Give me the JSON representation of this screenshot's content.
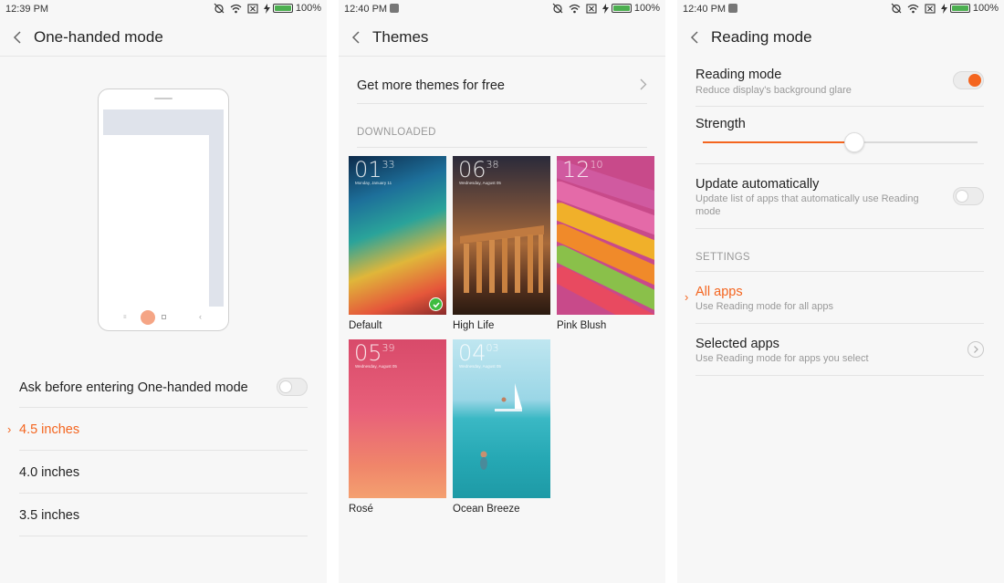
{
  "screen1": {
    "time": "12:39 PM",
    "battery": "100%",
    "title": "One-handed mode",
    "ask_label": "Ask before entering One-handed mode",
    "ask_toggle": false,
    "sizes": [
      {
        "label": "4.5 inches",
        "selected": true
      },
      {
        "label": "4.0 inches",
        "selected": false
      },
      {
        "label": "3.5 inches",
        "selected": false
      }
    ]
  },
  "screen2": {
    "time": "12:40 PM",
    "battery": "100%",
    "title": "Themes",
    "more_label": "Get more themes for free",
    "section": "DOWNLOADED",
    "themes": [
      {
        "name": "Default",
        "clock_h": "01",
        "clock_m": "33",
        "date": "Monday, January 11",
        "applied": true
      },
      {
        "name": "High Life",
        "clock_h": "06",
        "clock_m": "38",
        "date": "Wednesday, August 05",
        "applied": false
      },
      {
        "name": "Pink Blush",
        "clock_h": "12",
        "clock_m": "10",
        "date": "",
        "applied": false
      },
      {
        "name": "Rosé",
        "clock_h": "05",
        "clock_m": "39",
        "date": "Wednesday, August 05",
        "applied": false
      },
      {
        "name": "Ocean Breeze",
        "clock_h": "04",
        "clock_m": "03",
        "date": "Wednesday, August 05",
        "applied": false
      }
    ]
  },
  "screen3": {
    "time": "12:40 PM",
    "battery": "100%",
    "title": "Reading mode",
    "reading_title": "Reading mode",
    "reading_sub": "Reduce display's background glare",
    "reading_toggle": true,
    "strength_label": "Strength",
    "strength_value": 0.55,
    "update_title": "Update automatically",
    "update_sub": "Update list of apps that automatically use Reading mode",
    "update_toggle": false,
    "settings_head": "SETTINGS",
    "all_title": "All apps",
    "all_sub": "Use Reading mode for all apps",
    "selected_title": "Selected apps",
    "selected_sub": "Use Reading mode for apps you select"
  },
  "colors": {
    "accent": "#f4651f",
    "battery": "#4caf50",
    "check": "#3fbc3f"
  }
}
